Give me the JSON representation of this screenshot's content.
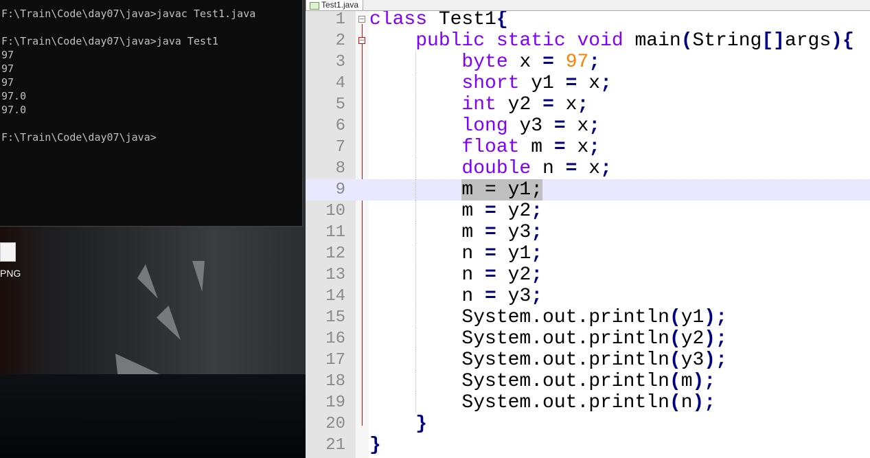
{
  "terminal": {
    "lines": [
      "F:\\Train\\Code\\day07\\java>javac Test1.java",
      "",
      "F:\\Train\\Code\\day07\\java>java Test1",
      "97",
      "97",
      "97",
      "97.0",
      "97.0",
      "",
      "F:\\Train\\Code\\day07\\java>"
    ]
  },
  "desktop": {
    "icon_label": "PNG"
  },
  "editor": {
    "tab_label": "Test1.java",
    "current_line": 9,
    "lines": [
      [
        [
          "kw",
          "class"
        ],
        [
          "t",
          " Test1"
        ],
        [
          "op",
          "{"
        ]
      ],
      [
        [
          "t",
          "    "
        ],
        [
          "kw",
          "public static void"
        ],
        [
          "t",
          " main"
        ],
        [
          "op",
          "("
        ],
        [
          "t",
          "String"
        ],
        [
          "op",
          "[]"
        ],
        [
          "t",
          "args"
        ],
        [
          "op",
          "){"
        ]
      ],
      [
        [
          "t",
          "        "
        ],
        [
          "kw",
          "byte"
        ],
        [
          "t",
          " x "
        ],
        [
          "op",
          "="
        ],
        [
          "t",
          " "
        ],
        [
          "num",
          "97"
        ],
        [
          "op",
          ";"
        ]
      ],
      [
        [
          "t",
          "        "
        ],
        [
          "kw",
          "short"
        ],
        [
          "t",
          " y1 "
        ],
        [
          "op",
          "="
        ],
        [
          "t",
          " x"
        ],
        [
          "op",
          ";"
        ]
      ],
      [
        [
          "t",
          "        "
        ],
        [
          "kw",
          "int"
        ],
        [
          "t",
          " y2 "
        ],
        [
          "op",
          "="
        ],
        [
          "t",
          " x"
        ],
        [
          "op",
          ";"
        ]
      ],
      [
        [
          "t",
          "        "
        ],
        [
          "kw",
          "long"
        ],
        [
          "t",
          " y3 "
        ],
        [
          "op",
          "="
        ],
        [
          "t",
          " x"
        ],
        [
          "op",
          ";"
        ]
      ],
      [
        [
          "t",
          "        "
        ],
        [
          "kw",
          "float"
        ],
        [
          "t",
          " m "
        ],
        [
          "op",
          "="
        ],
        [
          "t",
          " x"
        ],
        [
          "op",
          ";"
        ]
      ],
      [
        [
          "t",
          "        "
        ],
        [
          "kw",
          "double"
        ],
        [
          "t",
          " n "
        ],
        [
          "op",
          "="
        ],
        [
          "t",
          " x"
        ],
        [
          "op",
          ";"
        ]
      ],
      [
        [
          "t",
          "        "
        ],
        [
          "sel",
          "m = y1;"
        ]
      ],
      [
        [
          "t",
          "        m "
        ],
        [
          "op",
          "="
        ],
        [
          "t",
          " y2"
        ],
        [
          "op",
          ";"
        ]
      ],
      [
        [
          "t",
          "        m "
        ],
        [
          "op",
          "="
        ],
        [
          "t",
          " y3"
        ],
        [
          "op",
          ";"
        ]
      ],
      [
        [
          "t",
          "        n "
        ],
        [
          "op",
          "="
        ],
        [
          "t",
          " y1"
        ],
        [
          "op",
          ";"
        ]
      ],
      [
        [
          "t",
          "        n "
        ],
        [
          "op",
          "="
        ],
        [
          "t",
          " y2"
        ],
        [
          "op",
          ";"
        ]
      ],
      [
        [
          "t",
          "        n "
        ],
        [
          "op",
          "="
        ],
        [
          "t",
          " y3"
        ],
        [
          "op",
          ";"
        ]
      ],
      [
        [
          "t",
          "        System.out.println"
        ],
        [
          "op",
          "("
        ],
        [
          "t",
          "y1"
        ],
        [
          "op",
          ");"
        ]
      ],
      [
        [
          "t",
          "        System.out.println"
        ],
        [
          "op",
          "("
        ],
        [
          "t",
          "y2"
        ],
        [
          "op",
          ");"
        ]
      ],
      [
        [
          "t",
          "        System.out.println"
        ],
        [
          "op",
          "("
        ],
        [
          "t",
          "y3"
        ],
        [
          "op",
          ");"
        ]
      ],
      [
        [
          "t",
          "        System.out.println"
        ],
        [
          "op",
          "("
        ],
        [
          "t",
          "m"
        ],
        [
          "op",
          ");"
        ]
      ],
      [
        [
          "t",
          "        System.out.println"
        ],
        [
          "op",
          "("
        ],
        [
          "t",
          "n"
        ],
        [
          "op",
          ");"
        ]
      ],
      [
        [
          "t",
          "    "
        ],
        [
          "op",
          "}"
        ]
      ],
      [
        [
          "op",
          "}"
        ]
      ]
    ]
  },
  "colors": {
    "keyword": "#8000ff",
    "number": "#ff8000",
    "operator": "#000080",
    "current_line": "#e8e8ff",
    "selection": "#c0c0c0"
  }
}
